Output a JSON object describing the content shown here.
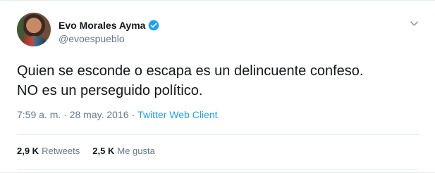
{
  "author": {
    "name": "Evo Morales Ayma",
    "handle": "@evoespueblo",
    "verified": true
  },
  "tweet": {
    "line1": "Quien se esconde o escapa es un delincuente confeso.",
    "line2": "NO es un perseguido político."
  },
  "meta": {
    "timestamp": "7:59 a. m. · 28 may. 2016",
    "separator": "·",
    "client": "Twitter Web Client"
  },
  "stats": {
    "retweets_count": "2,9 K",
    "retweets_label": "Retweets",
    "likes_count": "2,5 K",
    "likes_label": "Me gusta"
  },
  "colors": {
    "accent": "#1da1f2",
    "text": "#14171a",
    "secondary": "#657786",
    "border": "#e6ecf0"
  },
  "icons": {
    "verified": "verified-badge-icon",
    "caret": "chevron-down-icon"
  }
}
